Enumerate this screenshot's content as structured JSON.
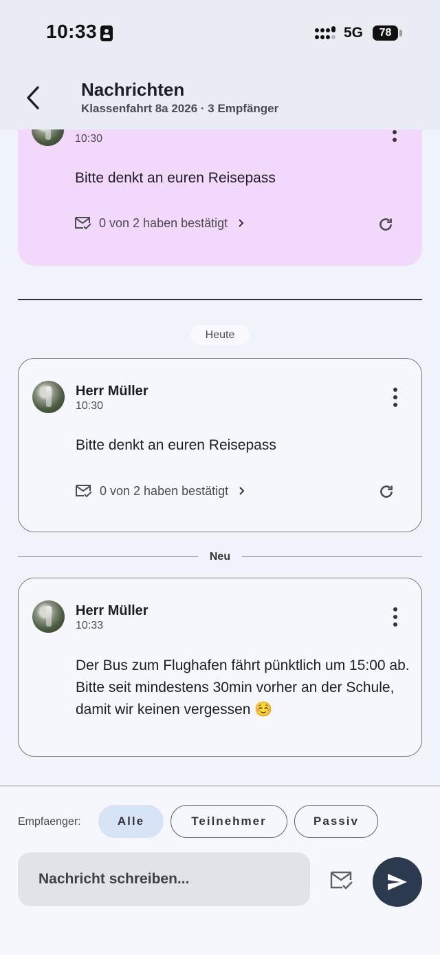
{
  "status_bar": {
    "time": "10:33",
    "network": "5G",
    "battery": "78"
  },
  "app_bar": {
    "title": "Nachrichten",
    "subtitle": "Klassenfahrt 8a 2026 · 3 Empfänger"
  },
  "messages": [
    {
      "time": "10:30",
      "text": "Bitte denkt an euren Reisepass",
      "ack": "0 von 2 haben bestätigt"
    },
    {
      "sender": "Herr Müller",
      "time": "10:30",
      "text": "Bitte denkt an euren Reisepass",
      "ack": "0 von 2 haben bestätigt"
    },
    {
      "sender": "Herr Müller",
      "time": "10:33",
      "text": "Der Bus zum Flughafen fährt pünktlich um 15:00 ab. Bitte seit mindestens 30min vorher an der Schule, damit wir keinen vergessen ☺️"
    }
  ],
  "date_chip": "Heute",
  "new_separator": "Neu",
  "composer": {
    "recipient_label": "Empfaenger:",
    "recipient_options": [
      "Alle",
      "Teilnehmer",
      "Passiv"
    ],
    "selected_recipient": "Alle",
    "placeholder": "Nachricht schreiben..."
  },
  "colors": {
    "highlight_card": "#f2d8fb",
    "selected_chip": "#d7e4f6",
    "send_button": "#2b3a4f"
  },
  "icons": {
    "back": "arrow-back-icon",
    "more": "more-vert-icon",
    "ack": "mark-email-read-icon",
    "chevron": "chevron-right-icon",
    "refresh": "refresh-icon",
    "send": "send-icon"
  }
}
